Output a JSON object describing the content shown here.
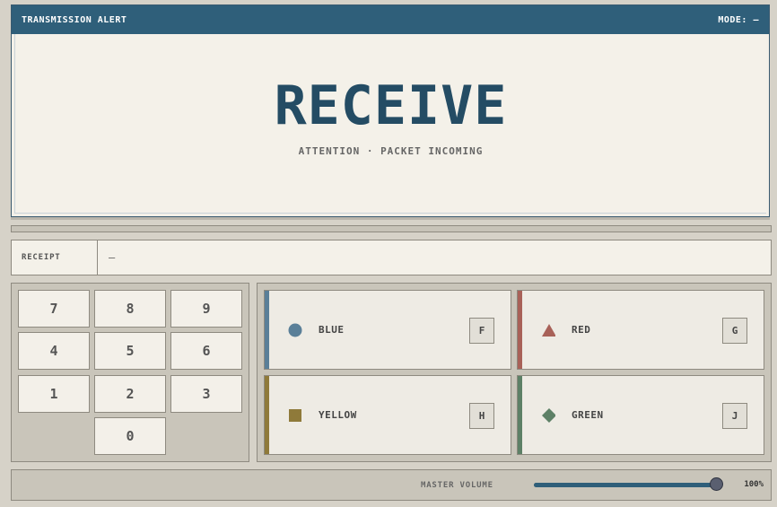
{
  "alert": {
    "title": "TRANSMISSION ALERT",
    "mode": "MODE: —",
    "headline": "RECEIVE",
    "subline": "ATTENTION · PACKET INCOMING"
  },
  "receipt": {
    "label": "RECEIPT",
    "value": "—"
  },
  "keypad": {
    "keys": [
      "7",
      "8",
      "9",
      "4",
      "5",
      "6",
      "1",
      "2",
      "3",
      "0"
    ]
  },
  "colors": {
    "buttons": [
      {
        "label": "BLUE",
        "hotkey": "F",
        "color": "#5a7f98",
        "icon": "circle-icon"
      },
      {
        "label": "RED",
        "hotkey": "G",
        "color": "#a86158",
        "icon": "triangle-icon"
      },
      {
        "label": "YELLOW",
        "hotkey": "H",
        "color": "#8f7a3a",
        "icon": "square-icon"
      },
      {
        "label": "GREEN",
        "hotkey": "J",
        "color": "#5d8066",
        "icon": "diamond-icon"
      }
    ]
  },
  "volume": {
    "label": "MASTER VOLUME",
    "value_text": "100%",
    "level": 1.0
  },
  "theme": {
    "header": "#2f5f7a",
    "headline": "#244c64"
  }
}
